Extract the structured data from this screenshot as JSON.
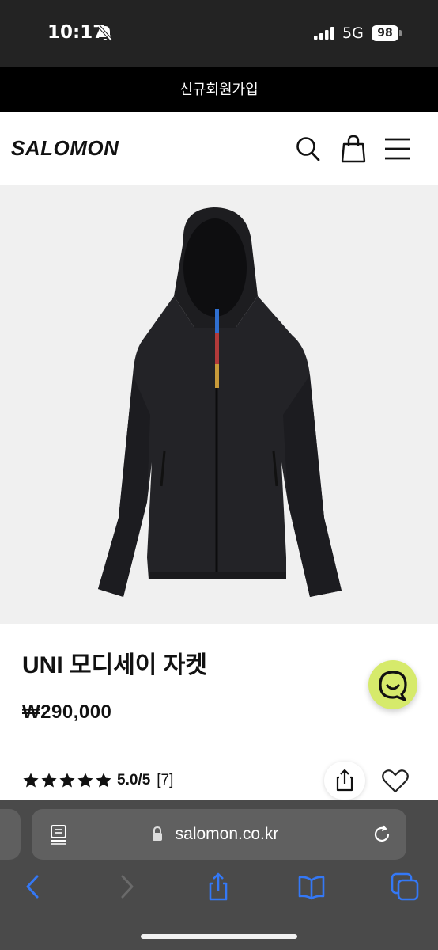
{
  "status_bar": {
    "time": "10:17",
    "network": "5G",
    "battery": "98",
    "icons": [
      "bell-slash-icon",
      "signal-icon"
    ]
  },
  "banner": {
    "signup_label": "신규회원가입"
  },
  "header": {
    "logo": "SALOMON",
    "icons": [
      "search-icon",
      "shopping-bag-icon",
      "menu-icon"
    ]
  },
  "product": {
    "image": "black-hooded-jacket",
    "title": "UNI 모디세이 자켓",
    "price": "₩290,000",
    "rating": {
      "stars": 5,
      "max_stars": 5,
      "text": "5.0/5",
      "review_count": "[7]"
    }
  },
  "actions": {
    "icons": [
      "chat-icon",
      "share-icon",
      "heart-icon"
    ],
    "chat_color": "#d6ea6b"
  },
  "browser": {
    "address": "salomon.co.kr",
    "icons": [
      "reader-icon",
      "lock-icon",
      "reload-icon",
      "back-icon",
      "forward-icon",
      "share-icon",
      "bookmarks-icon",
      "tabs-icon"
    ],
    "accent": "#3478f6"
  }
}
